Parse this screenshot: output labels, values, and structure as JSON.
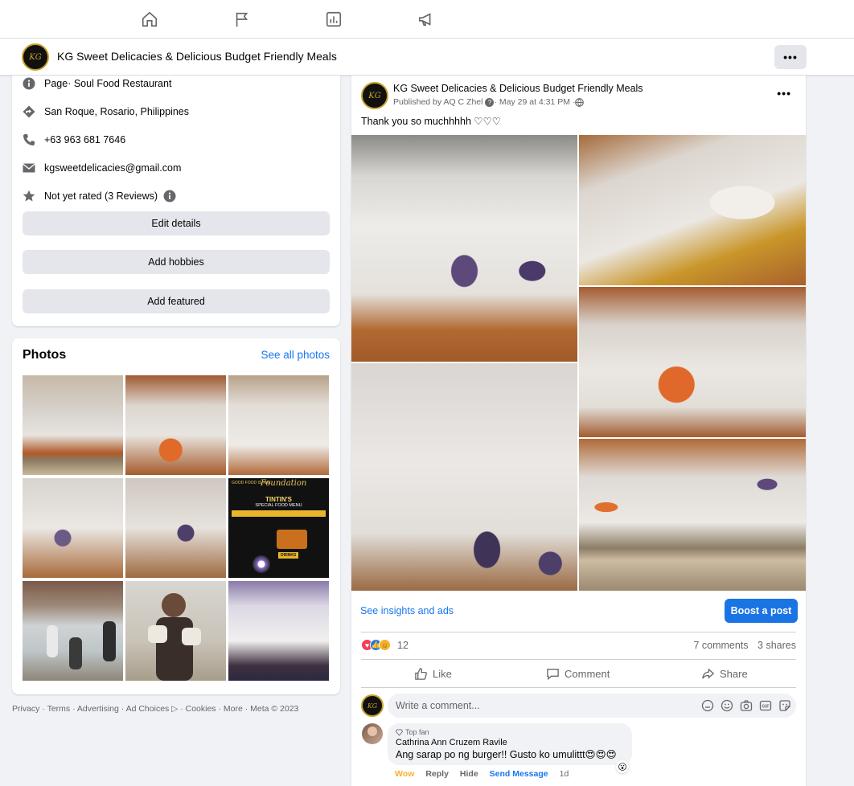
{
  "nav": {
    "icons": [
      "home-icon",
      "flag-icon",
      "insights-icon",
      "megaphone-icon"
    ]
  },
  "page": {
    "name": "KG Sweet Delicacies & Delicious Budget Friendly Meals",
    "avatar_text": "KG",
    "more_label": "•••"
  },
  "intro": {
    "category_prefix": "Page",
    "category": " · Soul Food Restaurant",
    "address": "San Roque, Rosario, Philippines",
    "phone": "+63 963 681 7646",
    "email": "kgsweetdelicacies@gmail.com",
    "rating": "Not yet rated (3 Reviews)",
    "buttons": {
      "edit": "Edit details",
      "hobbies": "Add hobbies",
      "featured": "Add featured"
    }
  },
  "photos": {
    "title": "Photos",
    "see_all": "See all photos",
    "menu_card": {
      "top_line": "GOOD FOOD IS THE",
      "script": "Foundation",
      "brand": "TINTIN'S",
      "subtitle": "SPECIAL FOOD MENU",
      "drinks": "DRINKS"
    }
  },
  "footer": {
    "text": "Privacy · Terms · Advertising · Ad Choices ▷ · Cookies · More · Meta © 2023"
  },
  "post": {
    "author": "KG Sweet Delicacies & Delicious Budget Friendly Meals",
    "published_by": "Published by AQ C Zhel",
    "date": " · May 29 at 4:31 PM · ",
    "text": "Thank you so muchhhhh ♡♡♡",
    "more_label": "•••",
    "insights_link": "See insights and ads",
    "boost_label": "Boost a post",
    "reaction_count": "12",
    "comments_count": "7 comments",
    "shares_count": "3 shares",
    "actions": {
      "like": "Like",
      "comment": "Comment",
      "share": "Share"
    },
    "comment_placeholder": "Write a comment..."
  },
  "comment": {
    "badge": "Top fan",
    "author": "Cathrina Ann Cruzem Ravile",
    "text": "Ang sarap po ng burger!! Gusto ko umulittt😍😍😍",
    "reaction_emoji": "😮",
    "actions": {
      "wow": "Wow",
      "reply": "Reply",
      "hide": "Hide",
      "send": "Send Message",
      "time": "1d"
    }
  },
  "colors": {
    "accent": "#1877f2",
    "boost": "#1b74e4",
    "background": "#f0f2f5",
    "secondary_text": "#65676b",
    "brand_gold": "#c9a227"
  }
}
